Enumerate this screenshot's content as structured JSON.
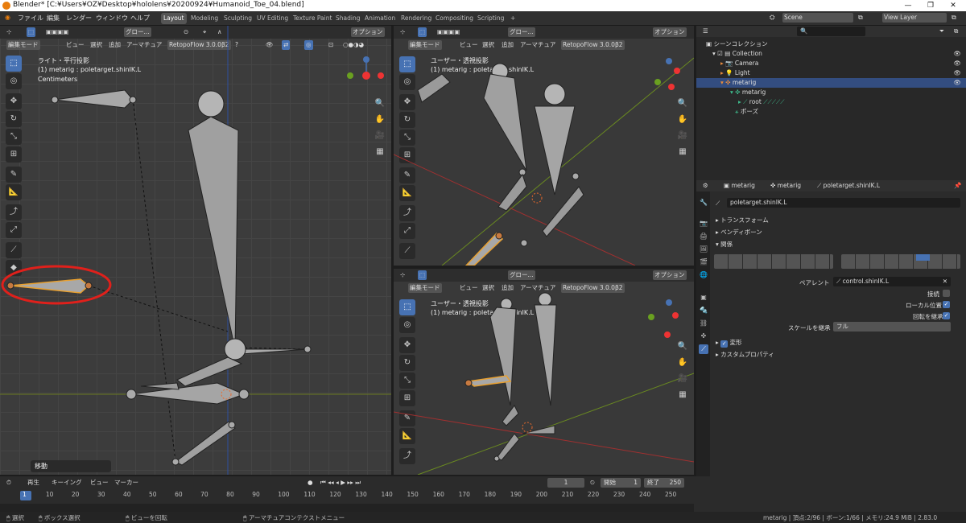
{
  "window": {
    "title": "Blender* [C:¥Users¥OZ¥Desktop¥hololens¥20200924¥Humanoid_Toe_04.blend]",
    "minimize": "—",
    "maximize": "❐",
    "close": "✕"
  },
  "menu": {
    "items": [
      "ファイル",
      "編集",
      "レンダー",
      "ウィンドウ",
      "ヘルプ"
    ]
  },
  "workspaces": [
    "Layout",
    "Modeling",
    "Sculpting",
    "UV Editing",
    "Texture Paint",
    "Shading",
    "Animation",
    "Rendering",
    "Compositing",
    "Scripting",
    "+"
  ],
  "scene": {
    "label": "Scene",
    "view_layer": "View Layer"
  },
  "viewport_header": {
    "orientation": "グロー...",
    "options": "オプション",
    "mode": "編集モード",
    "menus": [
      "ビュー",
      "選択",
      "追加",
      "アーマチュア"
    ],
    "addon": "RetopoFlow 3.0.0β2"
  },
  "viewport_left": {
    "view_name": "ライト・平行投影",
    "object": "(1) metarig : poletarget.shinIK.L",
    "units": "Centimeters",
    "last_op": "移動"
  },
  "viewport_right_top": {
    "view_name": "ユーザー・透視投影",
    "object": "(1) metarig : poletarget.shinIK.L"
  },
  "viewport_right_bottom": {
    "view_name": "ユーザー・透視投影",
    "object": "(1) metarig : poletarget.shinIK.L"
  },
  "outliner": {
    "title": "シーンコレクション",
    "rows": [
      {
        "label": "Collection"
      },
      {
        "label": "Camera"
      },
      {
        "label": "Light"
      },
      {
        "label": "metarig"
      },
      {
        "label": "metarig"
      },
      {
        "label": "root"
      },
      {
        "label": "ポーズ"
      }
    ]
  },
  "properties": {
    "breadcrumb": [
      "metarig",
      "metarig",
      "poletarget.shinIK.L"
    ],
    "bone_name": "poletarget.shinIK.L",
    "panels": {
      "transform": "トランスフォーム",
      "bendy": "ベンディボーン",
      "relations": "関係",
      "deform": "変形",
      "custom": "カスタムプロパティ"
    },
    "parent_label": "ペアレント",
    "parent_value": "control.shinIK.L",
    "connected_label": "接続",
    "local_location_label": "ローカル位置",
    "inherit_rotation_label": "回転を継承",
    "inherit_scale_label": "スケールを継承",
    "inherit_scale_value": "フル"
  },
  "timeline": {
    "menus": [
      "再生",
      "キーイング",
      "ビュー",
      "マーカー"
    ],
    "current_frame": "1",
    "start_label": "開始",
    "start": "1",
    "end_label": "終了",
    "end": "250",
    "ticks": [
      "1",
      "10",
      "20",
      "30",
      "40",
      "50",
      "60",
      "70",
      "80",
      "90",
      "100",
      "110",
      "120",
      "130",
      "140",
      "150",
      "160",
      "170",
      "180",
      "190",
      "200",
      "210",
      "220",
      "230",
      "240",
      "250"
    ]
  },
  "statusbar": {
    "select": "選択",
    "box_select": "ボックス選択",
    "rotate_view": "ビューを回転",
    "context_menu": "アーマチュアコンテクストメニュー",
    "stats": "metarig | 頂点:2/96 | ボーン:1/66 | メモリ:24.9 MiB | 2.83.0"
  },
  "colors": {
    "accent": "#4772b3",
    "selected_bone": "#e8a030",
    "annotation": "#e0201b"
  }
}
